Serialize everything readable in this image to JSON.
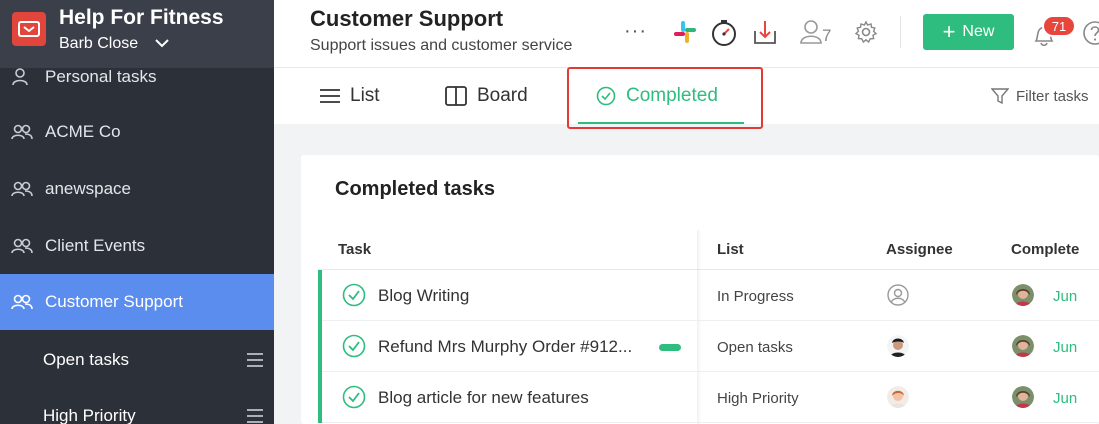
{
  "workspace": {
    "name": "Help For Fitness",
    "user": "Barb Close"
  },
  "sidebar": {
    "items": [
      {
        "label": "Personal tasks"
      },
      {
        "label": "ACME Co"
      },
      {
        "label": "anewspace"
      },
      {
        "label": "Client Events"
      },
      {
        "label": "Customer Support"
      }
    ],
    "subitems": [
      {
        "label": "Open tasks"
      },
      {
        "label": "High Priority"
      }
    ]
  },
  "header": {
    "title": "Customer Support",
    "subtitle": "Support issues and customer service",
    "member_count": "7",
    "new_label": "New",
    "notification_count": "71"
  },
  "tabs": [
    {
      "label": "List"
    },
    {
      "label": "Board"
    },
    {
      "label": "Completed"
    }
  ],
  "filter_label": "Filter tasks",
  "panel": {
    "title": "Completed tasks",
    "columns": {
      "task": "Task",
      "list": "List",
      "assignee": "Assignee",
      "completed": "Complete"
    }
  },
  "rows": [
    {
      "task": "Blog Writing",
      "list": "In Progress",
      "date": "Jun"
    },
    {
      "task": "Refund Mrs Murphy Order #912...",
      "list": "Open tasks",
      "date": "Jun"
    },
    {
      "task": "Blog article for new features",
      "list": "High Priority",
      "date": "Jun"
    }
  ],
  "colors": {
    "accent": "#2ebd7e",
    "sidebar": "#2c3039",
    "active": "#5b8def",
    "badge": "#e8453c"
  }
}
